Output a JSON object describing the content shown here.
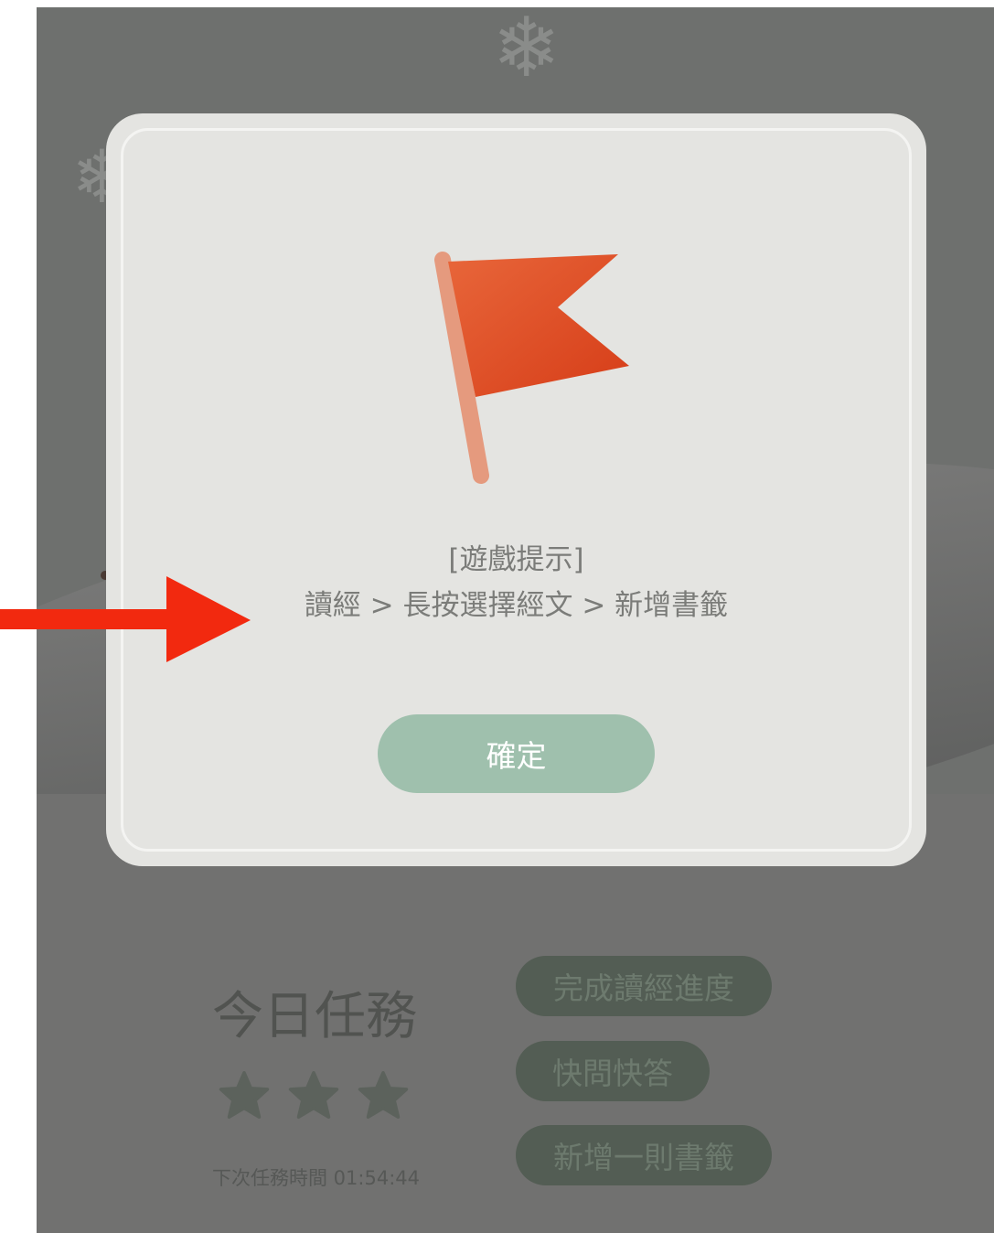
{
  "dialog": {
    "hint_title": "[遊戲提示]",
    "hint_path": "讀經 > 長按選擇經文 > 新增書籤",
    "confirm_label": "確定"
  },
  "task_section": {
    "title": "今日任務",
    "next_time": "下次任務時間 01:54:44",
    "buttons": [
      "完成讀經進度",
      "快問快答",
      "新增一則書籤"
    ],
    "stars_filled": 0,
    "stars_total": 3
  },
  "icons": {
    "dialog_icon": "flag-icon",
    "annotation": "arrow-right-icon",
    "background": "snowflake-icon"
  },
  "colors": {
    "overlay": "#6e706e",
    "dialog_bg": "#e4e4e1",
    "confirm_button": "#9fc0ad",
    "flag": "#e8502a",
    "annotation_arrow": "#f2290f",
    "task_button": "#535d54"
  }
}
